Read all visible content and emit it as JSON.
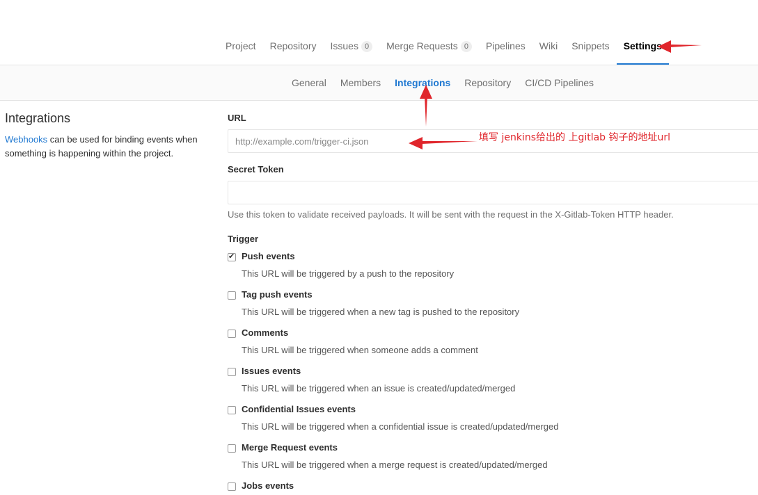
{
  "topnav": {
    "items": [
      {
        "label": "Project"
      },
      {
        "label": "Repository"
      },
      {
        "label": "Issues",
        "badge": "0"
      },
      {
        "label": "Merge Requests",
        "badge": "0"
      },
      {
        "label": "Pipelines"
      },
      {
        "label": "Wiki"
      },
      {
        "label": "Snippets"
      },
      {
        "label": "Settings",
        "active": true
      }
    ]
  },
  "subnav": {
    "items": [
      {
        "label": "General"
      },
      {
        "label": "Members"
      },
      {
        "label": "Integrations",
        "active": true
      },
      {
        "label": "Repository"
      },
      {
        "label": "CI/CD Pipelines"
      }
    ]
  },
  "sidebar": {
    "title": "Integrations",
    "link_text": "Webhooks",
    "description": " can be used for binding events when something is happening within the project."
  },
  "form": {
    "url_label": "URL",
    "url_placeholder": "http://example.com/trigger-ci.json",
    "url_value": "",
    "token_label": "Secret Token",
    "token_value": "",
    "token_help": "Use this token to validate received payloads. It will be sent with the request in the X-Gitlab-Token HTTP header.",
    "trigger_label": "Trigger",
    "triggers": [
      {
        "title": "Push events",
        "desc": "This URL will be triggered by a push to the repository",
        "checked": true
      },
      {
        "title": "Tag push events",
        "desc": "This URL will be triggered when a new tag is pushed to the repository",
        "checked": false
      },
      {
        "title": "Comments",
        "desc": "This URL will be triggered when someone adds a comment",
        "checked": false
      },
      {
        "title": "Issues events",
        "desc": "This URL will be triggered when an issue is created/updated/merged",
        "checked": false
      },
      {
        "title": "Confidential Issues events",
        "desc": "This URL will be triggered when a confidential issue is created/updated/merged",
        "checked": false
      },
      {
        "title": "Merge Request events",
        "desc": "This URL will be triggered when a merge request is created/updated/merged",
        "checked": false
      },
      {
        "title": "Jobs events",
        "desc": "",
        "checked": false
      }
    ]
  },
  "annotation": {
    "text": "填写 jenkins给出的 上gitlab 钩子的地址url",
    "color": "#e0262c"
  },
  "colors": {
    "accent": "#1f78d1",
    "annotation_red": "#e0262c"
  }
}
